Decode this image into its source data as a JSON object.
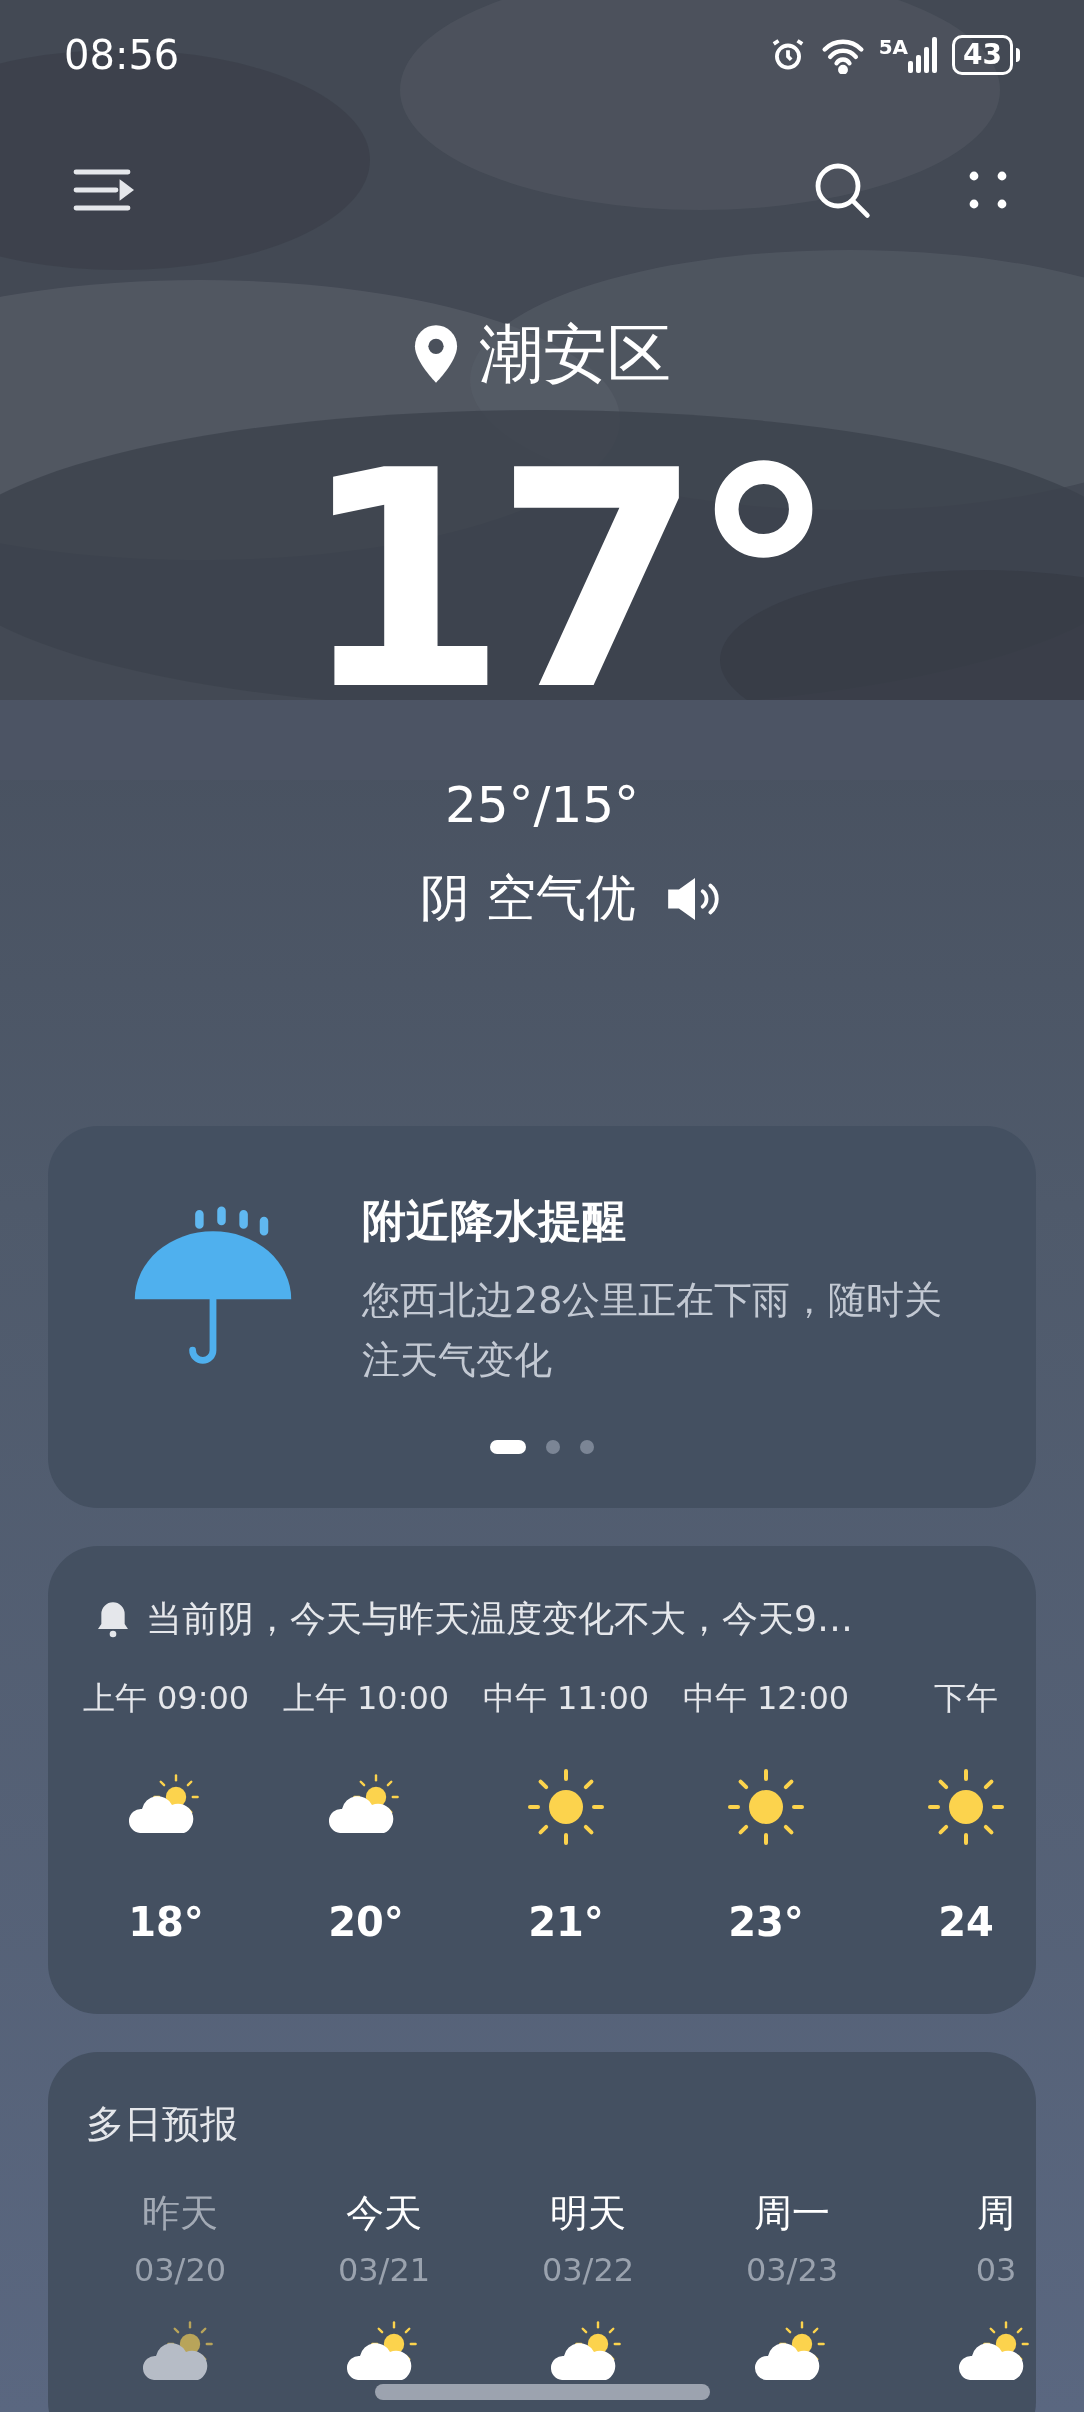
{
  "status_bar": {
    "time": "08:56",
    "network": "5A",
    "battery": "43"
  },
  "location": "潮安区",
  "temperature": "17°",
  "range": "25°/15°",
  "condition": "阴 空气优",
  "alert_card": {
    "title": "附近降水提醒",
    "text": "您西北边28公里正在下雨，随时关注天气变化",
    "dots": [
      {
        "selected": true
      },
      {
        "selected": false
      },
      {
        "selected": false
      }
    ]
  },
  "hourly": {
    "summary": "当前阴，今天与昨天温度变化不大，今天9…",
    "items": [
      {
        "time": "上午 09:00",
        "kind": "partly_cloudy",
        "temp": "18°"
      },
      {
        "time": "上午 10:00",
        "kind": "partly_cloudy",
        "temp": "20°"
      },
      {
        "time": "中午 11:00",
        "kind": "sunny",
        "temp": "21°"
      },
      {
        "time": "中午 12:00",
        "kind": "sunny",
        "temp": "23°"
      },
      {
        "time": "下午",
        "kind": "sunny",
        "temp": "24"
      }
    ]
  },
  "daily": {
    "title": "多日预报",
    "items": [
      {
        "day": "昨天",
        "date": "03/20",
        "kind": "partly_cloudy",
        "past": true
      },
      {
        "day": "今天",
        "date": "03/21",
        "kind": "partly_cloudy",
        "past": false
      },
      {
        "day": "明天",
        "date": "03/22",
        "kind": "partly_cloudy",
        "past": false
      },
      {
        "day": "周一",
        "date": "03/23",
        "kind": "partly_cloudy",
        "past": false
      },
      {
        "day": "周",
        "date": "03",
        "kind": "partly_cloudy",
        "past": false
      }
    ]
  }
}
